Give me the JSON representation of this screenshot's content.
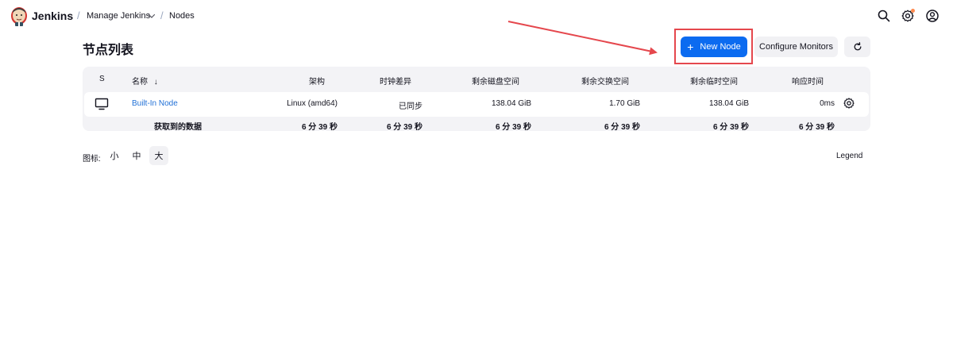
{
  "header": {
    "brand": "Jenkins",
    "breadcrumbs": [
      {
        "label": "Manage Jenkins"
      },
      {
        "label": "Nodes"
      }
    ],
    "separator": "/",
    "icons": [
      "search-icon",
      "gear-icon",
      "user-icon"
    ]
  },
  "page": {
    "title": "节点列表",
    "new_node_label": "New Node",
    "new_node_plus": "+",
    "configure_monitors_label": "Configure Monitors"
  },
  "table": {
    "headers": {
      "status": "S",
      "name": "名称",
      "sort_arrow": "↓",
      "arch": "架构",
      "clock": "时钟差异",
      "disk": "剩余磁盘空间",
      "swap": "剩余交换空间",
      "temp": "剩余临时空间",
      "response": "响应时间"
    },
    "rows": [
      {
        "name": "Built-In Node",
        "arch": "Linux (amd64)",
        "clock": "已同步",
        "disk": "138.04 GiB",
        "swap": "1.70 GiB",
        "temp": "138.04 GiB",
        "response": "0ms"
      }
    ],
    "footer": {
      "label": "获取到的数据",
      "arch": "6 分 39 秒",
      "clock": "6 分 39 秒",
      "disk": "6 分 39 秒",
      "swap": "6 分 39 秒",
      "temp": "6 分 39 秒",
      "response": "6 分 39 秒"
    }
  },
  "icon_size": {
    "label": "图标:",
    "options": [
      "小",
      "中",
      "大"
    ],
    "selected": "大"
  },
  "legend_label": "Legend",
  "colors": {
    "primary": "#0b6bf0",
    "link": "#1f6fd6",
    "annotation": "#e5474d",
    "notification": "#fe8a4f"
  }
}
